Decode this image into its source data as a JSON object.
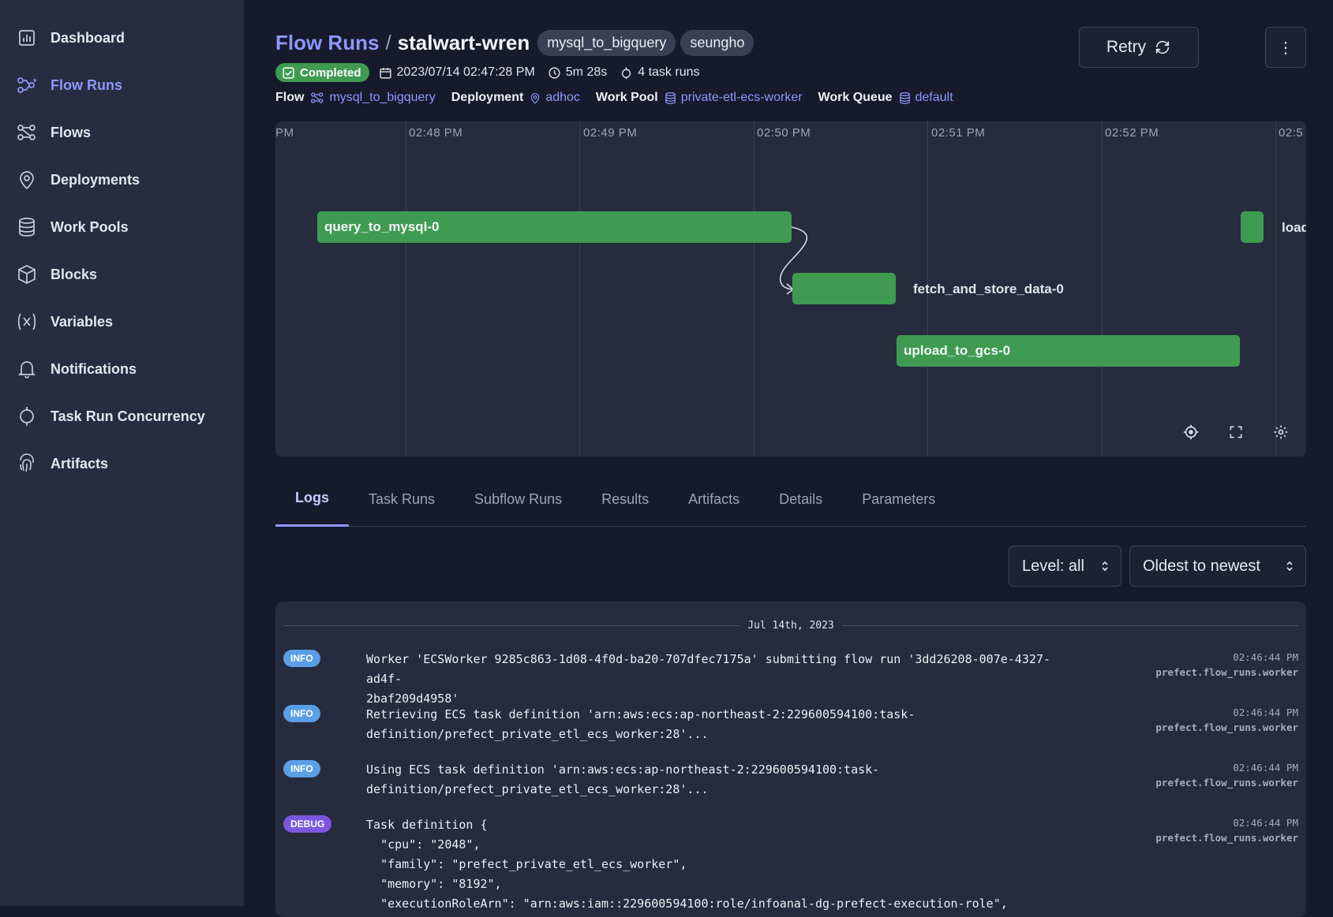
{
  "sidebar": {
    "items": [
      {
        "label": "Dashboard",
        "icon": "dashboard-icon"
      },
      {
        "label": "Flow Runs",
        "icon": "flow-runs-icon",
        "active": true
      },
      {
        "label": "Flows",
        "icon": "flows-icon"
      },
      {
        "label": "Deployments",
        "icon": "map-pin-icon"
      },
      {
        "label": "Work Pools",
        "icon": "database-icon"
      },
      {
        "label": "Blocks",
        "icon": "cube-icon"
      },
      {
        "label": "Variables",
        "icon": "variable-icon"
      },
      {
        "label": "Notifications",
        "icon": "bell-icon"
      },
      {
        "label": "Task Run Concurrency",
        "icon": "concurrency-icon"
      },
      {
        "label": "Artifacts",
        "icon": "fingerprint-icon"
      }
    ]
  },
  "header": {
    "breadcrumb_root": "Flow Runs",
    "separator": "/",
    "run_name": "stalwart-wren",
    "tags": [
      "mysql_to_bigquery",
      "seungho"
    ],
    "retry_label": "Retry",
    "more_label": "⋮"
  },
  "meta": {
    "status": "Completed",
    "start_time": "2023/07/14 02:47:28 PM",
    "duration": "5m 28s",
    "task_runs": "4 task runs"
  },
  "properties": {
    "flow_label": "Flow",
    "flow_value": "mysql_to_bigquery",
    "deployment_label": "Deployment",
    "deployment_value": "adhoc",
    "work_pool_label": "Work Pool",
    "work_pool_value": "private-etl-ecs-worker",
    "work_queue_label": "Work Queue",
    "work_queue_value": "default"
  },
  "timeline": {
    "ticks": [
      "PM",
      "02:48 PM",
      "02:49 PM",
      "02:50 PM",
      "02:51 PM",
      "02:52 PM",
      "02:5"
    ],
    "tasks": [
      {
        "name": "query_to_mysql-0",
        "label_inside": true
      },
      {
        "name": "fetch_and_store_data-0",
        "label_inside": false
      },
      {
        "name": "upload_to_gcs-0",
        "label_inside": true
      },
      {
        "name": "load",
        "label_inside": false
      }
    ],
    "bar_color": "#3f9b52"
  },
  "tabs": [
    "Logs",
    "Task Runs",
    "Subflow Runs",
    "Results",
    "Artifacts",
    "Details",
    "Parameters"
  ],
  "active_tab": "Logs",
  "filters": {
    "level": "Level: all",
    "order": "Oldest to newest"
  },
  "logs": {
    "date": "Jul 14th, 2023",
    "entries": [
      {
        "level": "INFO",
        "message": "Worker 'ECSWorker 9285c863-1d08-4f0d-ba20-707dfec7175a' submitting flow run '3dd26208-007e-4327-ad4f-\n2baf209d4958'",
        "time": "02:46:44 PM",
        "source": "prefect.flow_runs.worker"
      },
      {
        "level": "INFO",
        "message": "Retrieving ECS task definition 'arn:aws:ecs:ap-northeast-2:229600594100:task-\ndefinition/prefect_private_etl_ecs_worker:28'...",
        "time": "02:46:44 PM",
        "source": "prefect.flow_runs.worker"
      },
      {
        "level": "INFO",
        "message": "Using ECS task definition 'arn:aws:ecs:ap-northeast-2:229600594100:task-\ndefinition/prefect_private_etl_ecs_worker:28'...",
        "time": "02:46:44 PM",
        "source": "prefect.flow_runs.worker"
      },
      {
        "level": "DEBUG",
        "message": "Task definition {\n  \"cpu\": \"2048\",\n  \"family\": \"prefect_private_etl_ecs_worker\",\n  \"memory\": \"8192\",\n  \"executionRoleArn\": \"arn:aws:iam::229600594100:role/infoanal-dg-prefect-execution-role\",",
        "time": "02:46:44 PM",
        "source": "prefect.flow_runs.worker"
      }
    ]
  }
}
